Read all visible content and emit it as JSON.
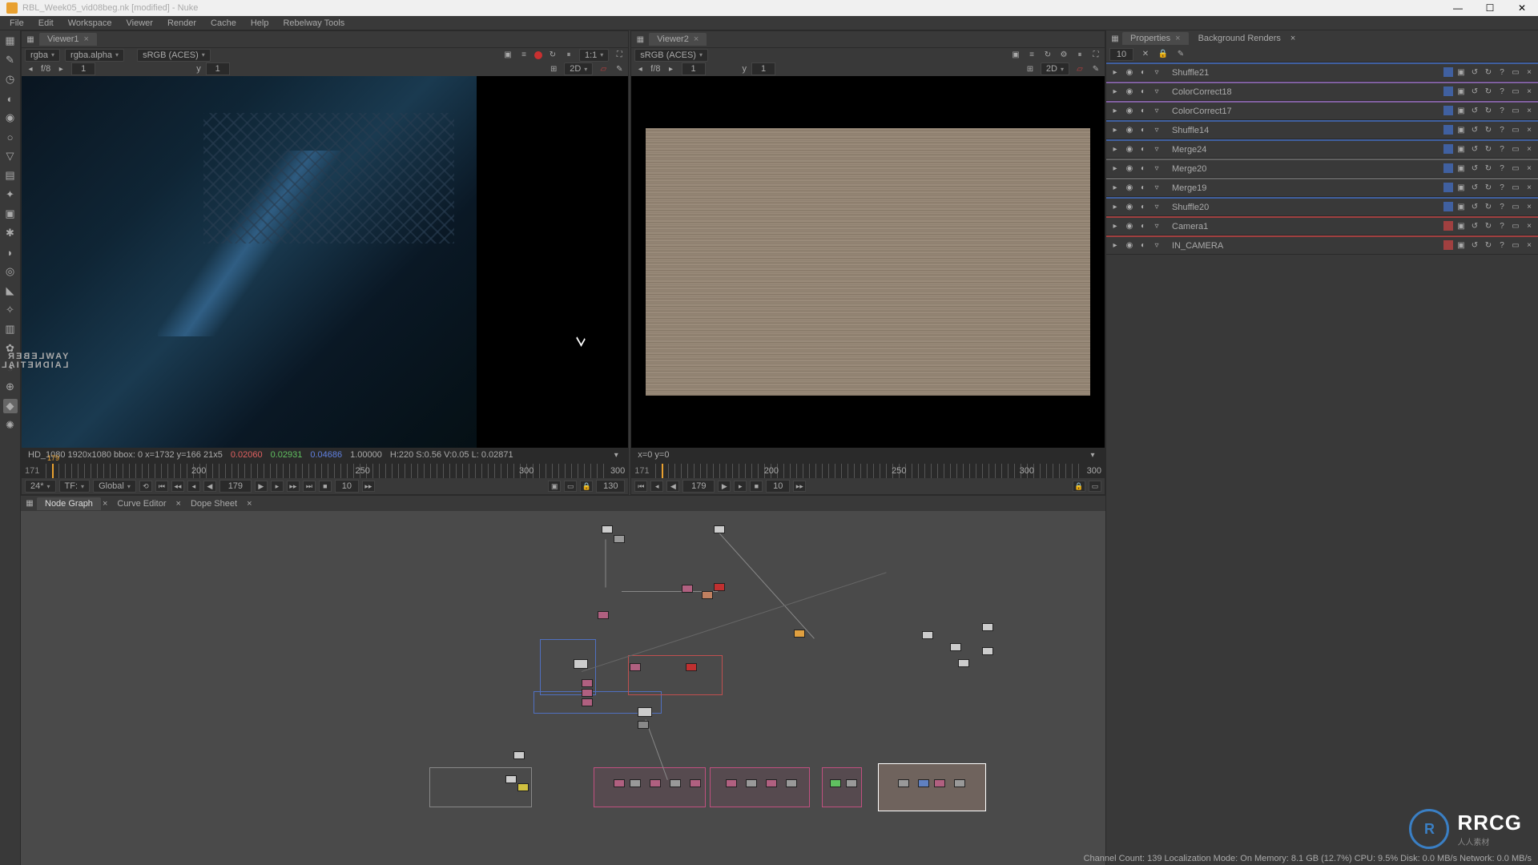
{
  "window": {
    "title": "RBL_Week05_vid08beg.nk [modified] - Nuke"
  },
  "menu": {
    "file": "File",
    "edit": "Edit",
    "workspace": "Workspace",
    "viewer": "Viewer",
    "render": "Render",
    "cache": "Cache",
    "help": "Help",
    "rebelway": "Rebelway Tools"
  },
  "viewer1": {
    "tab": "Viewer1",
    "channel": "rgba",
    "alpha": "rgba.alpha",
    "colorspace": "sRGB (ACES)",
    "ratio": "1:1",
    "f": "f/8",
    "y": "1",
    "mode2d": "2D",
    "overlay": "overlay off",
    "info": "HD_1080 1920x1080  bbox: 0   x=1732 y=166 21x5",
    "r": "0.02060",
    "g": "0.02931",
    "b": "0.04686",
    "a": "1.00000",
    "hsv": "H:220 S:0.56 V:0.05  L: 0.02871",
    "frame_start": "171",
    "frame_end": "300",
    "frame_cur": "179"
  },
  "viewer2": {
    "tab": "Viewer2",
    "colorspace": "sRGB (ACES)",
    "f": "f/8",
    "y": "1",
    "mode2d": "2D",
    "info": "x=0 y=0",
    "frame_start": "171",
    "frame_end": "300",
    "frame_cur": "179"
  },
  "timeline": {
    "zoom": "24*",
    "tf": "TF:",
    "global": "Global",
    "curframe": "179",
    "inc": "10",
    "range": "130",
    "marks": [
      "200",
      "250",
      "300"
    ],
    "marks2": [
      "200",
      "250",
      "300"
    ],
    "playhead": "179"
  },
  "bottom_tabs": {
    "node": "Node Graph",
    "curve": "Curve Editor",
    "dope": "Dope Sheet"
  },
  "properties": {
    "tab": "Properties",
    "bg": "Background Renders",
    "count": "10",
    "items": [
      {
        "name": "Shuffle21",
        "cls": "blue"
      },
      {
        "name": "ColorCorrect18",
        "cls": "purple"
      },
      {
        "name": "ColorCorrect17",
        "cls": "purple"
      },
      {
        "name": "Shuffle14",
        "cls": "blue"
      },
      {
        "name": "Merge24",
        "cls": "blue"
      },
      {
        "name": "Merge20",
        "cls": "grey"
      },
      {
        "name": "Merge19",
        "cls": "grey"
      },
      {
        "name": "Shuffle20",
        "cls": "blue"
      },
      {
        "name": "Camera1",
        "cls": "red"
      },
      {
        "name": "IN_CAMERA",
        "cls": "red"
      }
    ]
  },
  "status": {
    "text": "Channel Count: 139 Localization Mode: On Memory: 8.1 GB (12.7%) CPU: 9.5% Disk: 0.0 MB/s Network: 0.0 MB/s"
  },
  "watermark": {
    "left1": "YAWLEBER",
    "left2": "LAIDNETIAL",
    "brand": "RRCG",
    "sub": "人人素材"
  }
}
